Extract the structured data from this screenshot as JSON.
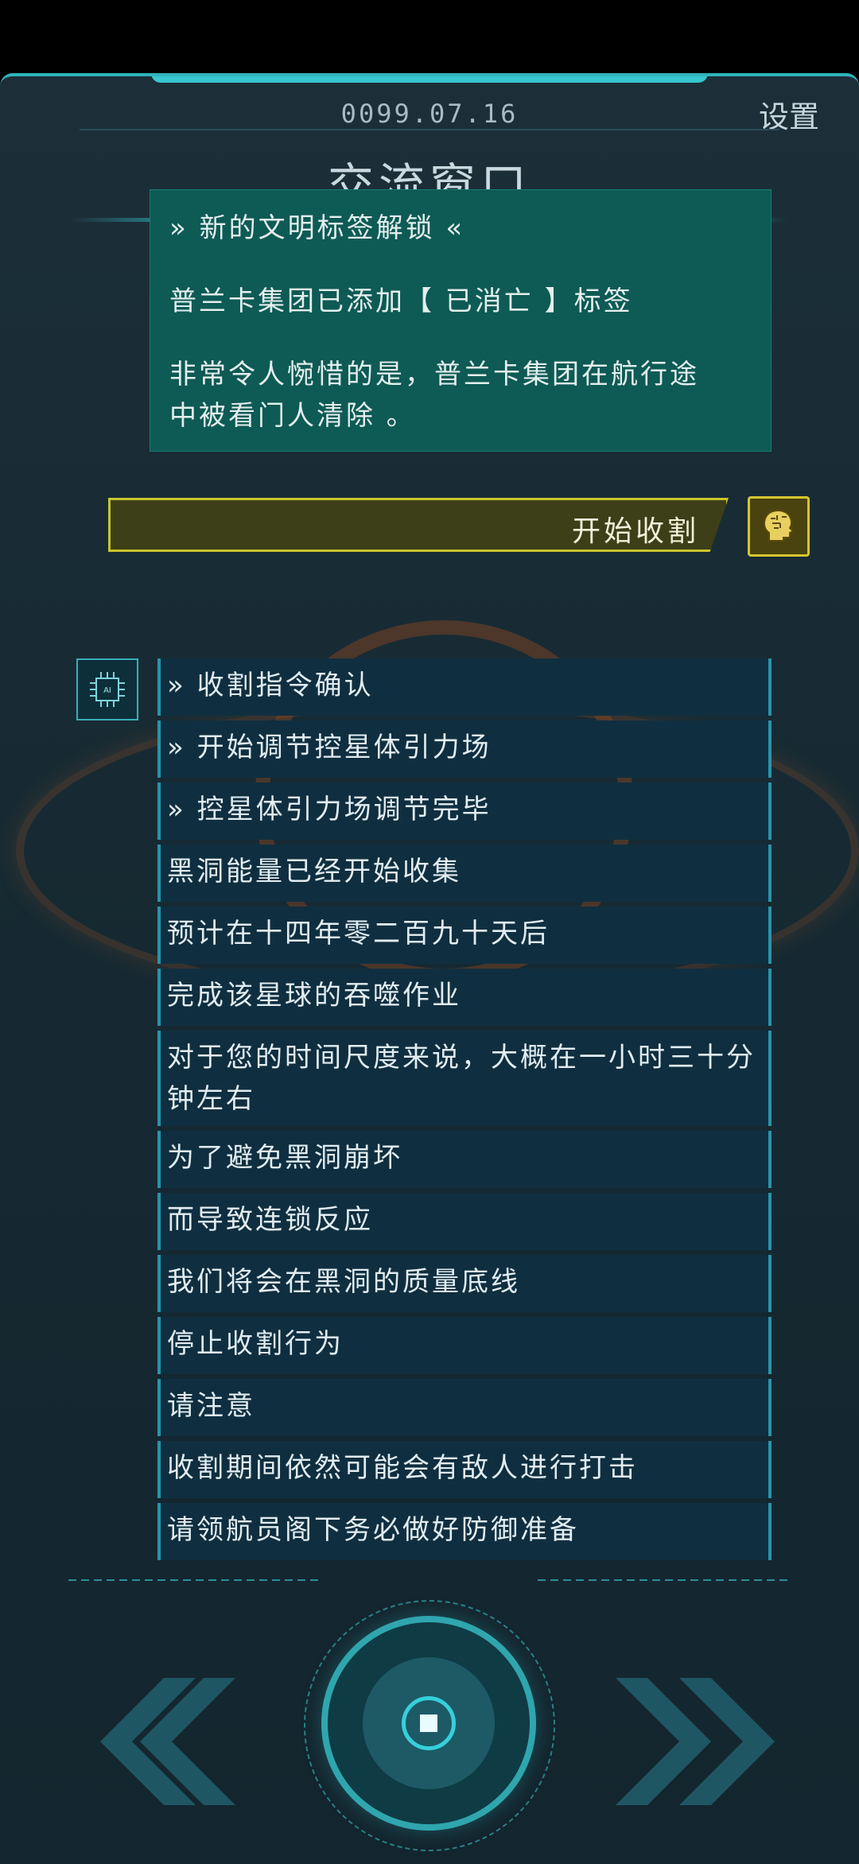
{
  "header": {
    "date": "0099.07.16",
    "settings_label": "设置",
    "title": "交流窗口"
  },
  "notice": {
    "line1": "» 新的文明标签解锁 «",
    "line2": "普兰卡集团已添加【 已消亡 】标签",
    "line3": "非常令人惋惜的是，普兰卡集团在航行途",
    "line4": "中被看门人清除 。"
  },
  "user_message": {
    "text": "开始收割",
    "avatar_icon": "brain-head-icon"
  },
  "ai": {
    "avatar_icon": "ai-chip-icon",
    "chip_text": "AI",
    "messages": [
      "» 收割指令确认",
      "» 开始调节控星体引力场",
      "» 控星体引力场调节完毕",
      "黑洞能量已经开始收集",
      "预计在十四年零二百九十天后",
      "完成该星球的吞噬作业",
      "对于您的时间尺度来说，大概在一小时三十分钟左右",
      "为了避免黑洞崩坏",
      "而导致连锁反应",
      "我们将会在黑洞的质量底线",
      "停止收割行为",
      "请注意",
      "收割期间依然可能会有敌人进行打击",
      "请领航员阁下务必做好防御准备"
    ]
  },
  "controls": {
    "prev_icon": "double-chevron-left-icon",
    "next_icon": "double-chevron-right-icon",
    "home_icon": "circle-core-button-icon"
  },
  "colors": {
    "accent": "#2fb3bd",
    "notice_bg": "#0e5a55",
    "user_bubble_border": "#c9c42c",
    "ai_bubble_bg": "#0f2f40"
  }
}
